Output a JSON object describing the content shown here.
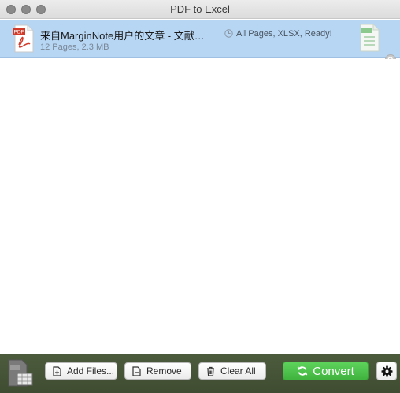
{
  "window": {
    "title": "PDF to Excel"
  },
  "file": {
    "name": "来自MarginNote用户的文章 - 文献…",
    "meta": "12 Pages, 2.3 MB",
    "status": "All Pages, XLSX, Ready!",
    "source_icon": "pdf-file-icon",
    "output_icon": "xlsx-file-icon"
  },
  "toolbar": {
    "add_label": "Add Files...",
    "remove_label": "Remove",
    "clear_label": "Clear All",
    "convert_label": "Convert"
  },
  "colors": {
    "selection": "#b6d6f4",
    "convert": "#4cc24a",
    "pdf_red": "#d23a2a",
    "xlsx_green": "#3fa34d"
  }
}
